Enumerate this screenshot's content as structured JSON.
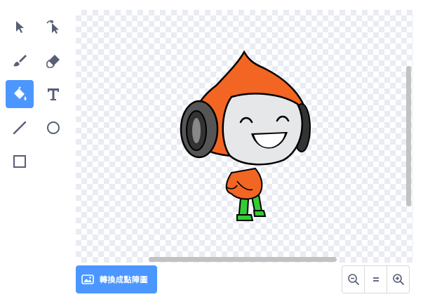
{
  "tools": {
    "items": [
      {
        "name": "select",
        "icon": "select-arrow-icon",
        "selected": false
      },
      {
        "name": "reshape",
        "icon": "reshape-icon",
        "selected": false
      },
      {
        "name": "brush",
        "icon": "brush-icon",
        "selected": false
      },
      {
        "name": "eraser",
        "icon": "eraser-icon",
        "selected": false
      },
      {
        "name": "fill",
        "icon": "fill-bucket-icon",
        "selected": true
      },
      {
        "name": "text",
        "icon": "text-T-icon",
        "selected": false
      },
      {
        "name": "line",
        "icon": "line-icon",
        "selected": false
      },
      {
        "name": "circle",
        "icon": "circle-icon",
        "selected": false
      },
      {
        "name": "rectangle",
        "icon": "rectangle-icon",
        "selected": false
      }
    ]
  },
  "convert_button": {
    "label": "轉換成點陣圖",
    "icon": "bitmap-image-icon"
  },
  "zoom": {
    "zoom_out_icon": "zoom-out-icon",
    "reset_icon": "zoom-reset-icon",
    "zoom_in_icon": "zoom-in-icon"
  },
  "colors": {
    "accent": "#4c97ff",
    "tool_icon": "#575e75",
    "character_orange": "#f26522",
    "character_green": "#33cc33"
  }
}
